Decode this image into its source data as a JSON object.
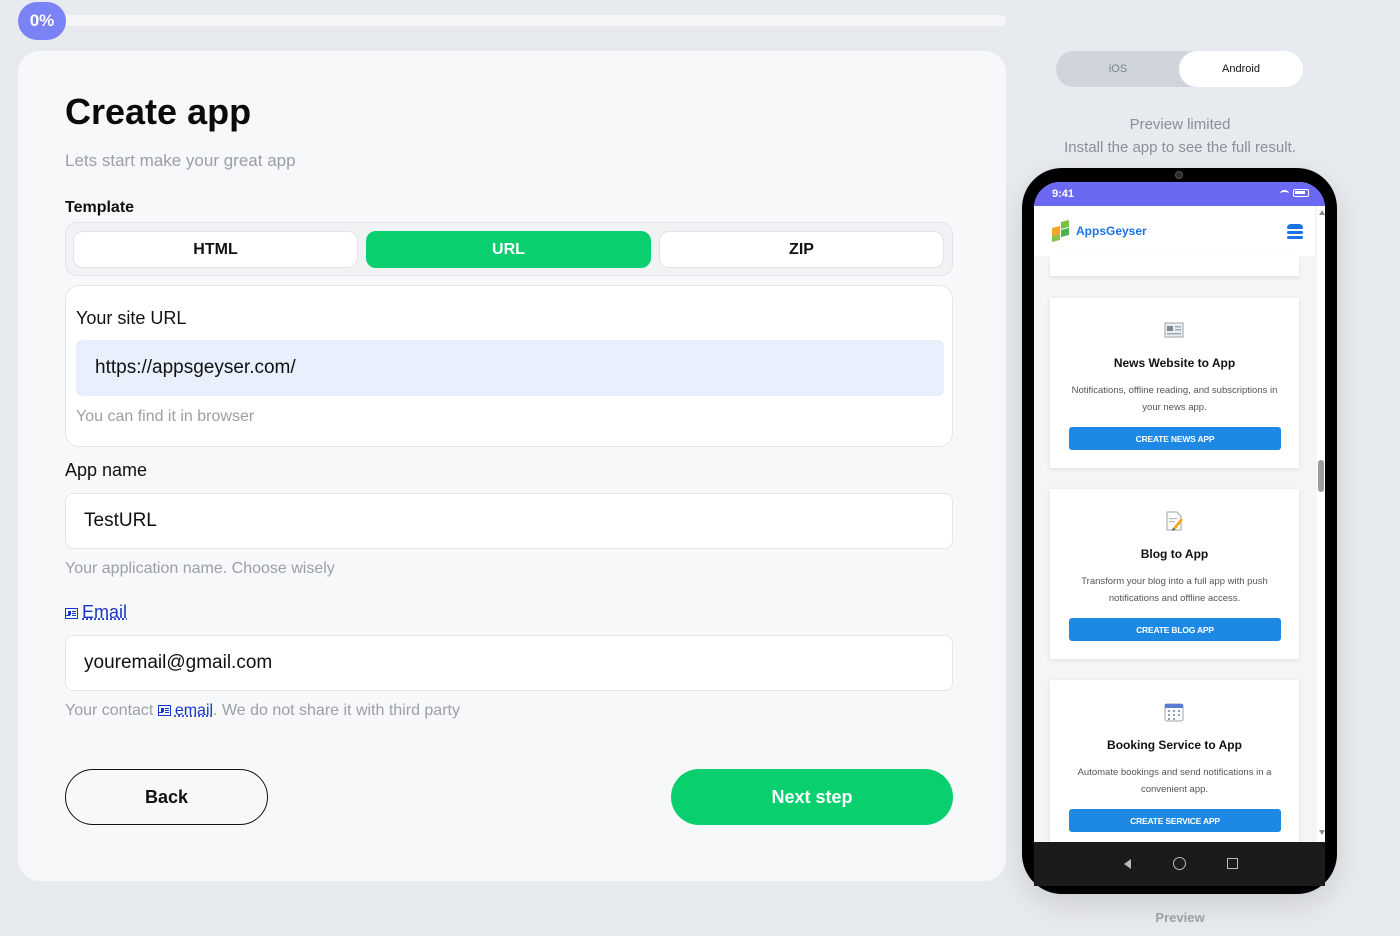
{
  "progress": {
    "label": "0%",
    "value": 0
  },
  "form": {
    "title": "Create app",
    "subtitle": "Lets start make your great app",
    "template_label": "Template",
    "templates": [
      "HTML",
      "URL",
      "ZIP"
    ],
    "selected_template": "URL",
    "site_url": {
      "label": "Your site URL",
      "value": "https://appsgeyser.com/",
      "hint": "You can find it in browser"
    },
    "app_name": {
      "label": "App name",
      "value": "TestURL",
      "hint": "Your application name. Choose wisely"
    },
    "email": {
      "label": "Email",
      "value": "youremail@gmail.com",
      "hint_prefix": "Your contact",
      "hint_link": "email",
      "hint_suffix": ". We do not share it with third party"
    },
    "back_label": "Back",
    "next_label": "Next step"
  },
  "preview": {
    "platforms": [
      "iOS",
      "Android"
    ],
    "selected_platform": "Android",
    "note_line1": "Preview limited",
    "note_line2": "Install the app to see the full result.",
    "caption": "Preview",
    "phone": {
      "time": "9:41",
      "app_title": "AppsGeyser",
      "cards": [
        {
          "icon": "newspaper-icon",
          "title": "News Website to App",
          "desc": "Notifications, offline reading, and subscriptions in your news app.",
          "button": "CREATE NEWS APP"
        },
        {
          "icon": "memo-icon",
          "title": "Blog to App",
          "desc": "Transform your blog into a full app with push notifications and offline access.",
          "button": "CREATE BLOG APP"
        },
        {
          "icon": "calendar-icon",
          "title": "Booking Service to App",
          "desc": "Automate bookings and send notifications in a convenient app.",
          "button": "CREATE SERVICE APP"
        }
      ]
    }
  },
  "colors": {
    "accent_green": "#0acf6f",
    "progress_purple": "#7b82f5",
    "phone_status": "#6b68f3",
    "app_blue": "#1e88e5"
  }
}
